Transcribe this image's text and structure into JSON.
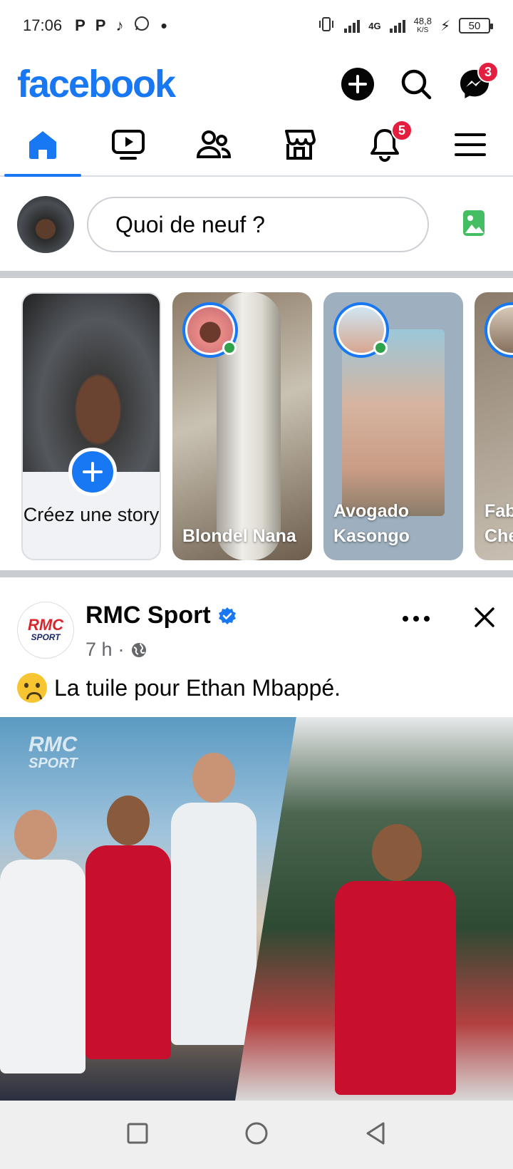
{
  "status_bar": {
    "time": "17:06",
    "network_type": "4G",
    "speed": "48,8",
    "speed_unit": "K/S",
    "battery": "50"
  },
  "header": {
    "logo": "facebook",
    "brand_color": "#1877f2",
    "messenger_badge": "3"
  },
  "nav": {
    "tabs": [
      "home",
      "video",
      "friends",
      "marketplace",
      "notifications",
      "menu"
    ],
    "notifications_badge": "5",
    "active": "home"
  },
  "composer": {
    "placeholder": "Quoi de neuf ?"
  },
  "stories": {
    "create_label": "Créez une story",
    "items": [
      {
        "name": "Blondel Nana"
      },
      {
        "name": "Avogado Kasongo"
      },
      {
        "name": "Fab Che"
      }
    ]
  },
  "post": {
    "page_name": "RMC Sport",
    "avatar_text_top": "RMC",
    "avatar_text_bottom": "SPORT",
    "time": "7 h",
    "separator": "·",
    "text": "La tuile pour Ethan Mbappé.",
    "image_watermark_top": "RMC",
    "image_watermark_bottom": "SPORT"
  }
}
